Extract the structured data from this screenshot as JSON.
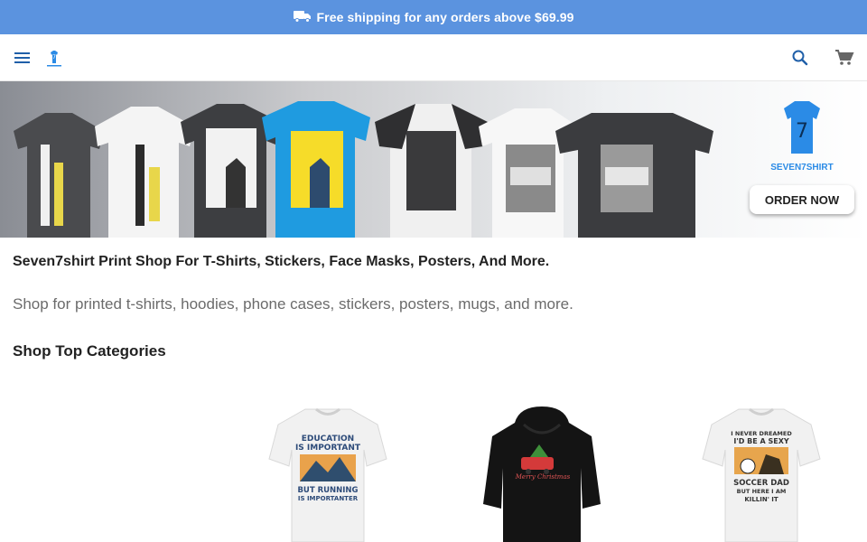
{
  "promo": {
    "text": "Free shipping for any orders above $69.99",
    "background": "#5b93df",
    "icon": "truck-icon"
  },
  "header": {
    "menu_icon": "menu-icon",
    "logo_icon": "logo-icon",
    "search_icon": "search-icon",
    "cart_icon": "cart-icon"
  },
  "banner": {
    "button_label": "ORDER NOW",
    "brand": "SEVEN7SHIRT",
    "brand_color": "#2b8be6"
  },
  "main": {
    "title": "Seven7shirt Print Shop For T-Shirts, Stickers, Face Masks, Posters, And More.",
    "subtitle": "Shop for printed t-shirts, hoodies, phone cases, stickers, posters, mugs, and more.",
    "categories_heading": "Shop Top Categories"
  },
  "products": [
    {
      "type": "white-tshirt",
      "print_lines": [
        "EDUCATION",
        "IS IMPORTANT",
        "BUT RUNNING",
        "IS IMPORTANTER"
      ]
    },
    {
      "type": "black-hoodie",
      "print_lines": [
        "Merry Christmas"
      ]
    },
    {
      "type": "white-tshirt",
      "print_lines": [
        "I NEVER DREAMED",
        "I'D BE A SEXY",
        "SOCCER DAD",
        "BUT HERE I AM",
        "KILLIN' IT"
      ]
    }
  ]
}
